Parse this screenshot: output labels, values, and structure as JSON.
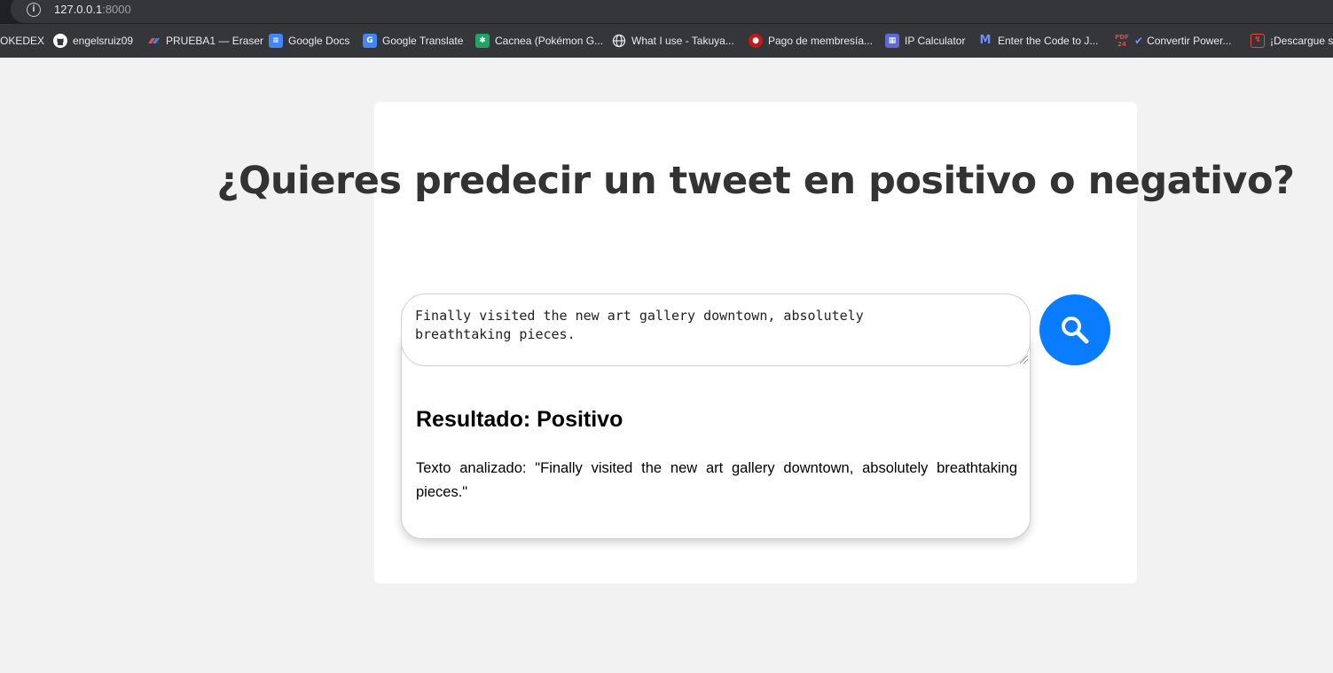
{
  "browser": {
    "url_host": "127.0.0.1",
    "url_port": ":8000",
    "bookmarks": [
      {
        "label": "OKEDEX",
        "icon": "none"
      },
      {
        "label": "engelsruiz09",
        "icon": "github-icon",
        "color": "#ffffff"
      },
      {
        "label": "PRUEBA1 — Eraser",
        "icon": "eraser-icon",
        "color": "#e84c5a"
      },
      {
        "label": "Google Docs",
        "icon": "docs-icon",
        "color": "#4285f4"
      },
      {
        "label": "Google Translate",
        "icon": "translate-icon",
        "color": "#4285f4"
      },
      {
        "label": "Cacnea (Pokémon G...",
        "icon": "cacnea-icon",
        "color": "#21a366"
      },
      {
        "label": "What I use - Takuya...",
        "icon": "globe-icon",
        "color": "#9aa0a6"
      },
      {
        "label": "Pago de membresía...",
        "icon": "membership-icon",
        "color": "#c41a1a"
      },
      {
        "label": "IP Calculator",
        "icon": "ip-calculator-icon",
        "color": "#5b6bd6"
      },
      {
        "label": "Enter the Code to J...",
        "icon": "code-icon",
        "color": "#3b5bdb"
      },
      {
        "label": "Convertir Power...",
        "icon": "pdf-icon",
        "color": "#7b61ff"
      },
      {
        "label": "¡Descargue su",
        "icon": "download-icon",
        "color": "#e8453c"
      }
    ]
  },
  "page": {
    "title": "¿Quieres predecir un tweet en positivo o negativo?",
    "input_value": "Finally visited the new art gallery downtown, absolutely breathtaking pieces.",
    "search_icon": "search-icon",
    "accent_color": "#0a7cff",
    "result": {
      "title": "Resultado: Positivo",
      "text": "Texto analizado: \"Finally visited the new art gallery downtown, absolutely breathtaking pieces.\""
    }
  }
}
